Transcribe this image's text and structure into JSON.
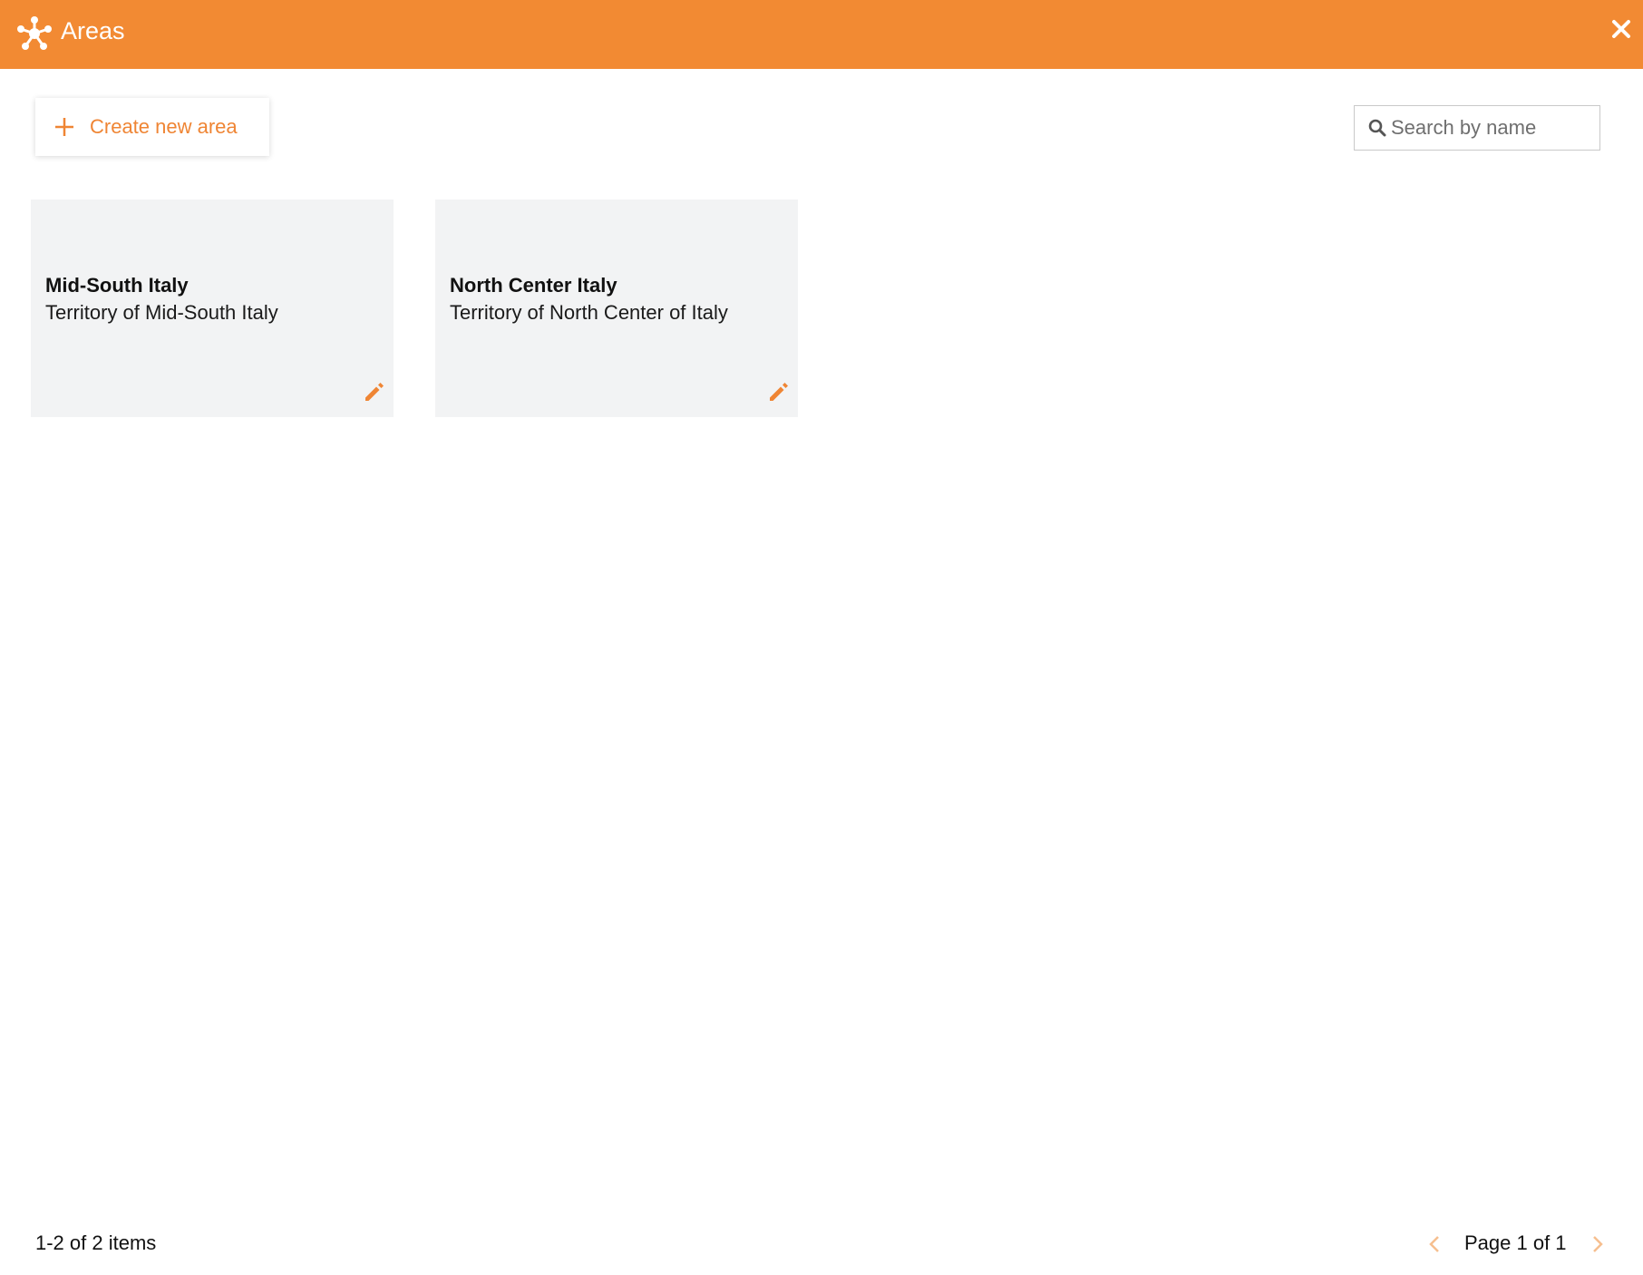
{
  "theme": {
    "accent": "#f28a33",
    "card_background": "#f2f3f4"
  },
  "header": {
    "title": "Areas",
    "logo_icon": "network-nodes-icon",
    "close_icon": "close-icon"
  },
  "toolbar": {
    "create_label": "Create new area",
    "create_icon": "plus-icon"
  },
  "search": {
    "placeholder": "Search by name",
    "value": "",
    "icon": "search-icon"
  },
  "areas": [
    {
      "name": "Mid-South Italy",
      "description": "Territory of Mid-South Italy",
      "edit_icon": "pencil-icon"
    },
    {
      "name": "North Center Italy",
      "description": "Territory of North Center of Italy",
      "edit_icon": "pencil-icon"
    }
  ],
  "footer": {
    "item_count": "1-2 of 2 items",
    "page_label": "Page 1 of 1",
    "prev_icon": "chevron-left-icon",
    "next_icon": "chevron-right-icon"
  }
}
